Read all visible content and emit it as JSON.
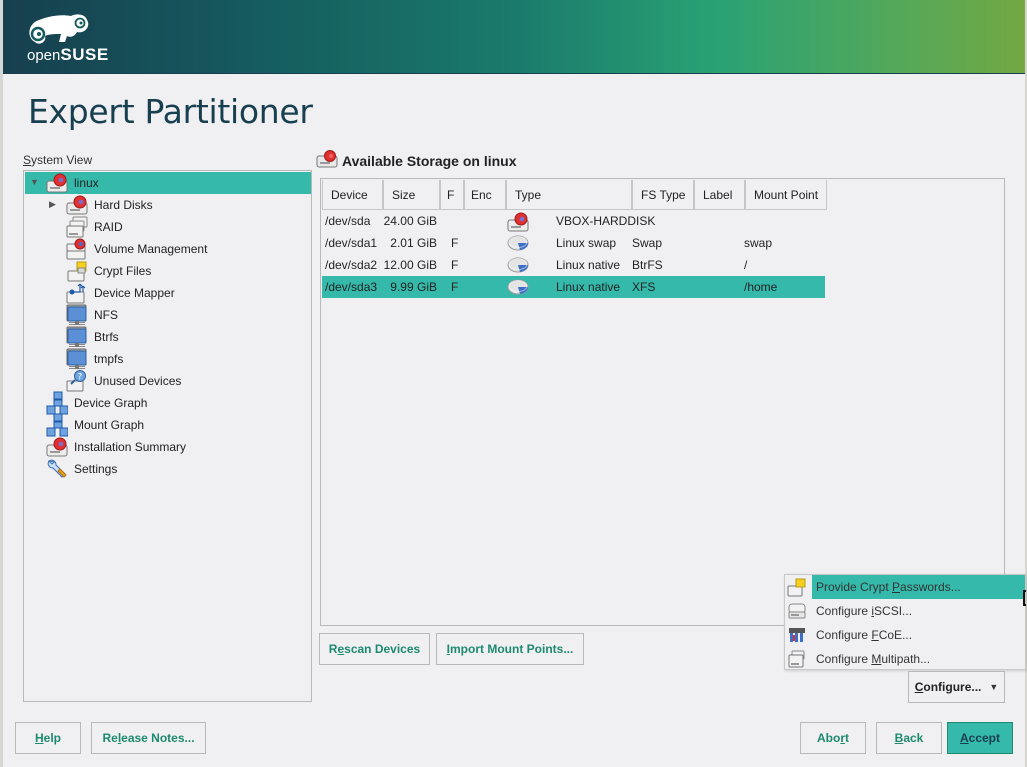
{
  "header": {
    "logo_text_light": "open",
    "logo_text_bold": "SUSE",
    "brand_colors": {
      "dark": "#173f4f",
      "mid": "#1a7a6c",
      "green": "#73a843",
      "accent": "#35b9ab",
      "link": "#1d8a6f"
    }
  },
  "page_title": "Expert Partitioner",
  "system_view": {
    "label_access": "S",
    "label_rest": "ystem View",
    "items": [
      {
        "label": "linux",
        "icon": "hard-disk-icon",
        "level": 0,
        "expanded": true,
        "selected": true
      },
      {
        "label": "Hard Disks",
        "icon": "hard-disk-icon",
        "level": 1,
        "expandable": true
      },
      {
        "label": "RAID",
        "icon": "raid-icon",
        "level": 1
      },
      {
        "label": "Volume Management",
        "icon": "volume-management-icon",
        "level": 1
      },
      {
        "label": "Crypt Files",
        "icon": "crypt-files-icon",
        "level": 1
      },
      {
        "label": "Device Mapper",
        "icon": "device-mapper-icon",
        "level": 1
      },
      {
        "label": "NFS",
        "icon": "network-folder-icon",
        "level": 1
      },
      {
        "label": "Btrfs",
        "icon": "network-folder-icon",
        "level": 1
      },
      {
        "label": "tmpfs",
        "icon": "network-folder-icon",
        "level": 1
      },
      {
        "label": "Unused Devices",
        "icon": "unused-devices-icon",
        "level": 1
      },
      {
        "label": "Device Graph",
        "icon": "graph-icon",
        "level": 0
      },
      {
        "label": "Mount Graph",
        "icon": "graph-icon",
        "level": 0
      },
      {
        "label": "Installation Summary",
        "icon": "hard-disk-icon",
        "level": 0
      },
      {
        "label": "Settings",
        "icon": "settings-wrench-icon",
        "level": 0
      }
    ]
  },
  "storage": {
    "title": "Available Storage on linux",
    "columns": [
      "Device",
      "Size",
      "F",
      "Enc",
      "Type",
      "FS Type",
      "Label",
      "Mount Point"
    ],
    "rows": [
      {
        "device": "/dev/sda",
        "size": "24.00 GiB",
        "f": "",
        "enc": "",
        "type": "VBOX-HARDDISK",
        "type_icon": "hard-disk-icon",
        "fs_type": "",
        "label": "",
        "mount_point": "",
        "selected": false
      },
      {
        "device": "/dev/sda1",
        "size": "2.01 GiB",
        "f": "F",
        "enc": "",
        "type": "Linux swap",
        "type_icon": "partition-icon",
        "fs_type": "Swap",
        "label": "",
        "mount_point": "swap",
        "selected": false
      },
      {
        "device": "/dev/sda2",
        "size": "12.00 GiB",
        "f": "F",
        "enc": "",
        "type": "Linux native",
        "type_icon": "partition-icon",
        "fs_type": "BtrFS",
        "label": "",
        "mount_point": "/",
        "selected": false
      },
      {
        "device": "/dev/sda3",
        "size": "9.99 GiB",
        "f": "F",
        "enc": "",
        "type": "Linux native",
        "type_icon": "partition-icon",
        "fs_type": "XFS",
        "label": "",
        "mount_point": "/home",
        "selected": true
      }
    ]
  },
  "buttons": {
    "rescan_pre": "R",
    "rescan_access": "e",
    "rescan_post": "scan Devices",
    "import_access": "I",
    "import_post": "mport Mount Points...",
    "configure_access": "C",
    "configure_post": "onfigure...",
    "help_access": "H",
    "help_post": "elp",
    "release_pre": "Re",
    "release_access": "l",
    "release_post": "ease Notes...",
    "abort_pre": "Abo",
    "abort_access": "r",
    "abort_post": "t",
    "back_access": "B",
    "back_post": "ack",
    "accept_access": "A",
    "accept_post": "ccept"
  },
  "configure_menu": {
    "items": [
      {
        "pre": "Provide Crypt ",
        "access": "P",
        "post": "asswords...",
        "icon": "crypt-passwords-icon",
        "highlighted": true
      },
      {
        "pre": "Configure ",
        "access": "i",
        "post": "SCSI...",
        "icon": "iscsi-icon",
        "highlighted": false
      },
      {
        "pre": "Configure ",
        "access": "F",
        "post": "CoE...",
        "icon": "fcoe-icon",
        "highlighted": false
      },
      {
        "pre": "Configure ",
        "access": "M",
        "post": "ultipath...",
        "icon": "multipath-icon",
        "highlighted": false
      }
    ]
  }
}
